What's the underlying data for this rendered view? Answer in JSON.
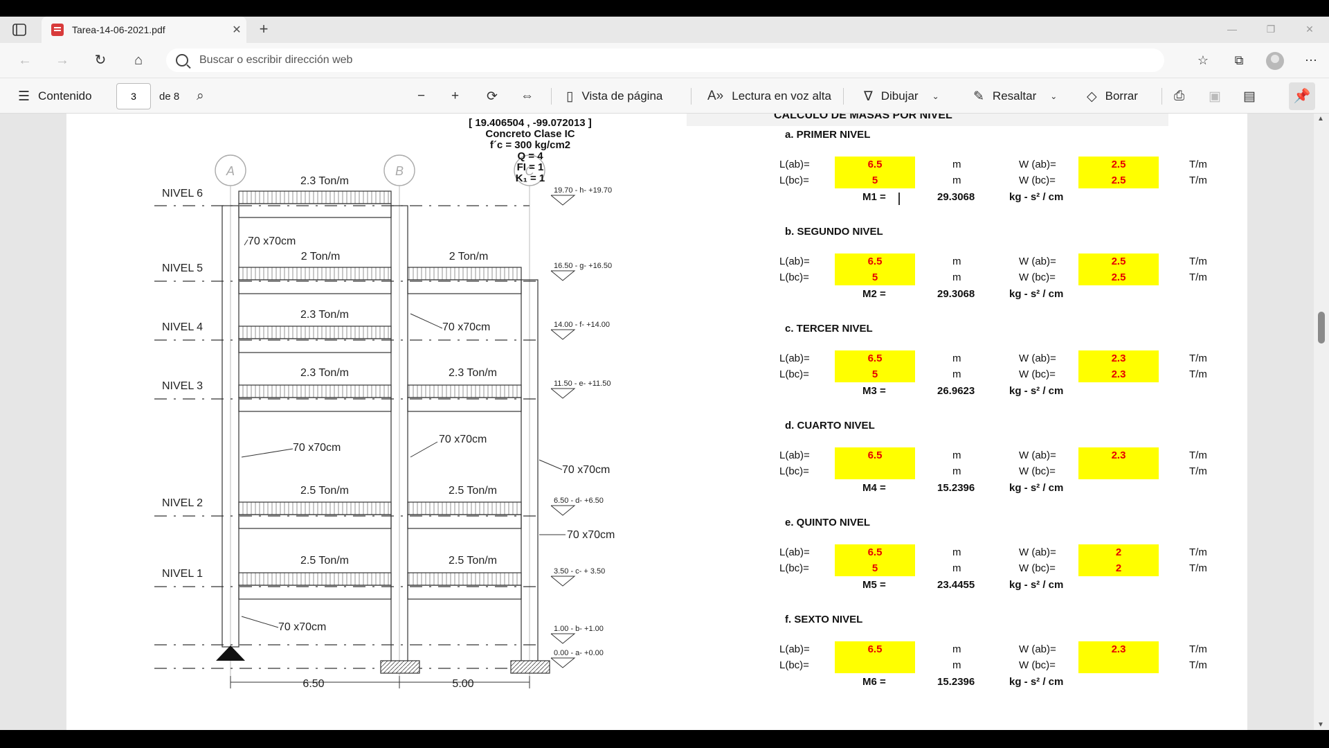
{
  "browser": {
    "tab_title": "Tarea-14-06-2021.pdf",
    "address_placeholder": "Buscar o escribir dirección web"
  },
  "pdf_toolbar": {
    "contents_label": "Contenido",
    "current_page": "3",
    "of_pages": "de 8",
    "page_view_label": "Vista de página",
    "read_aloud_label": "Lectura en voz alta",
    "draw_label": "Dibujar",
    "highlight_label": "Resaltar",
    "erase_label": "Borrar"
  },
  "drawing": {
    "header_lines": [
      "[ 19.406504 , -99.072013 ]",
      "Concreto Clase IC",
      "f´c = 300 kg/cm2",
      "Q = 4",
      "FI = 1",
      "K₁ = 1"
    ],
    "axes": [
      "A",
      "B",
      "C"
    ],
    "levels": [
      "NIVEL 6",
      "NIVEL 5",
      "NIVEL 4",
      "NIVEL 3",
      "NIVEL 2",
      "NIVEL 1"
    ],
    "loads": {
      "n6_ab": "2.3 Ton/m",
      "n5_ab": "2 Ton/m",
      "n5_bc": "2 Ton/m",
      "n4_ab": "2.3 Ton/m",
      "n3_ab": "2.3 Ton/m",
      "n3_bc": "2.3 Ton/m",
      "n2_ab": "2.5 Ton/m",
      "n2_bc": "2.5 Ton/m",
      "n1_ab": "2.5 Ton/m",
      "n1_bc": "2.5 Ton/m"
    },
    "section_label": "70 x70cm",
    "elevations": [
      "19.70 - h- +19.70",
      "16.50 - g- +16.50",
      "14.00 - f- +14.00",
      "11.50 - e- +11.50",
      "6.50 - d- +6.50",
      "3.50 - c- + 3.50",
      "1.00 - b- +1.00",
      "0.00 - a- +0.00"
    ],
    "spans": [
      "6.50",
      "5.00"
    ]
  },
  "calc": {
    "title": "CALCULO DE MASAS POR NIVEL",
    "labels": {
      "lab": "L(ab)=",
      "lbc": "L(bc)=",
      "wab": "W (ab)=",
      "wbc": "W (bc)=",
      "m": "m",
      "tm": "T/m",
      "unit": "kg - s² / cm"
    },
    "levels": [
      {
        "title": "a.  PRIMER  NIVEL",
        "lab": "6.5",
        "lbc": "5",
        "wab": "2.5",
        "wbc": "2.5",
        "m_label": "M1 =",
        "m_value": "29.3068"
      },
      {
        "title": "b.  SEGUNDO  NIVEL",
        "lab": "6.5",
        "lbc": "5",
        "wab": "2.5",
        "wbc": "2.5",
        "m_label": "M2 =",
        "m_value": "29.3068"
      },
      {
        "title": "c.  TERCER  NIVEL",
        "lab": "6.5",
        "lbc": "5",
        "wab": "2.3",
        "wbc": "2.3",
        "m_label": "M3 =",
        "m_value": "26.9623"
      },
      {
        "title": "d.  CUARTO  NIVEL",
        "lab": "6.5",
        "lbc": "",
        "wab": "2.3",
        "wbc": "",
        "m_label": "M4 =",
        "m_value": "15.2396"
      },
      {
        "title": "e.  QUINTO  NIVEL",
        "lab": "6.5",
        "lbc": "5",
        "wab": "2",
        "wbc": "2",
        "m_label": "M5 =",
        "m_value": "23.4455"
      },
      {
        "title": "f.  SEXTO  NIVEL",
        "lab": "6.5",
        "lbc": "",
        "wab": "2.3",
        "wbc": "",
        "m_label": "M6 =",
        "m_value": "15.2396"
      }
    ]
  }
}
